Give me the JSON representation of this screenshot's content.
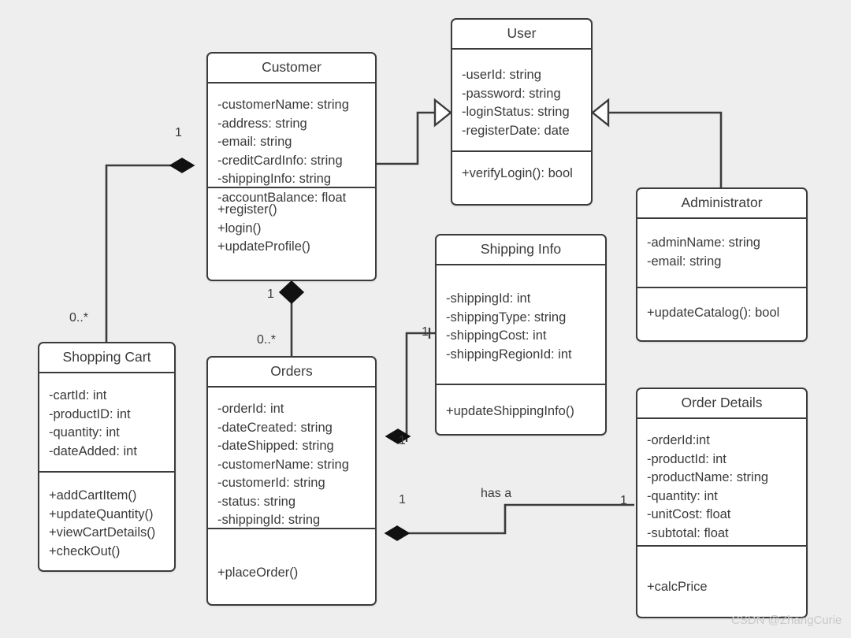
{
  "diagram": {
    "type": "uml-class-diagram",
    "background_color": "#eeeeee",
    "box_fill": "#ffffff",
    "line_color": "#3b3b3b",
    "text_color": "#3a3a3a",
    "watermark": "CSDN @ZhangCurie"
  },
  "classes": [
    {
      "id": "customer",
      "name": "Customer",
      "attributes": [
        "-customerName: string",
        "-address: string",
        "-email: string",
        "-creditCardInfo: string",
        "-shippingInfo: string",
        "-accountBalance: float"
      ],
      "operations": [
        "+register()",
        "+login()",
        "+updateProfile()"
      ]
    },
    {
      "id": "user",
      "name": "User",
      "attributes": [
        "-userId: string",
        "-password: string",
        "-loginStatus: string",
        "-registerDate: date"
      ],
      "operations": [
        "+verifyLogin(): bool"
      ]
    },
    {
      "id": "administrator",
      "name": "Administrator",
      "attributes": [
        "-adminName: string",
        "-email: string"
      ],
      "operations": [
        "+updateCatalog(): bool"
      ]
    },
    {
      "id": "shopping-cart",
      "name": "Shopping Cart",
      "attributes": [
        "-cartId: int",
        "-productID: int",
        "-quantity: int",
        "-dateAdded: int"
      ],
      "operations": [
        "+addCartItem()",
        "+updateQuantity()",
        "+viewCartDetails()",
        "+checkOut()"
      ]
    },
    {
      "id": "orders",
      "name": "Orders",
      "attributes": [
        "-orderId: int",
        "-dateCreated: string",
        "-dateShipped: string",
        "-customerName: string",
        "-customerId: string",
        "-status: string",
        "-shippingId: string"
      ],
      "operations": [
        "+placeOrder()"
      ]
    },
    {
      "id": "shipping-info",
      "name": "Shipping Info",
      "attributes": [
        "-shippingId: int",
        "-shippingType: string",
        "-shippingCost: int",
        "-shippingRegionId: int"
      ],
      "operations": [
        "+updateShippingInfo()"
      ]
    },
    {
      "id": "order-details",
      "name": "Order Details",
      "attributes": [
        "-orderId:int",
        "-productId: int",
        "-productName: string",
        "-quantity: int",
        "-unitCost: float",
        "-subtotal: float"
      ],
      "operations": [
        "+calcPrice"
      ]
    }
  ],
  "relationships": [
    {
      "id": "customer-shoppingcart",
      "kind": "composition",
      "from": "Customer",
      "to": "Shopping Cart",
      "source_multiplicity": "1",
      "target_multiplicity": "0..*",
      "label": ""
    },
    {
      "id": "customer-orders",
      "kind": "composition",
      "from": "Customer",
      "to": "Orders",
      "source_multiplicity": "1",
      "target_multiplicity": "0..*",
      "label": ""
    },
    {
      "id": "customer-user",
      "kind": "generalization",
      "from": "Customer",
      "to": "User",
      "source_multiplicity": "",
      "target_multiplicity": "",
      "label": ""
    },
    {
      "id": "administrator-user",
      "kind": "generalization",
      "from": "Administrator",
      "to": "User",
      "source_multiplicity": "",
      "target_multiplicity": "",
      "label": ""
    },
    {
      "id": "orders-shippinginfo",
      "kind": "composition",
      "from": "Orders",
      "to": "Shipping Info",
      "source_multiplicity": "1",
      "target_multiplicity": "1",
      "label": ""
    },
    {
      "id": "orders-orderdetails",
      "kind": "composition",
      "from": "Orders",
      "to": "Order Details",
      "source_multiplicity": "1",
      "target_multiplicity": "1",
      "label": "has a"
    }
  ],
  "edge_labels": {
    "cart_one": "1",
    "cart_many": "0..*",
    "orders_one": "1",
    "orders_many": "0..*",
    "shipping_near": "1",
    "shipping_far": "1",
    "details_near": "1",
    "details_far": "1",
    "has_a": "has a"
  }
}
